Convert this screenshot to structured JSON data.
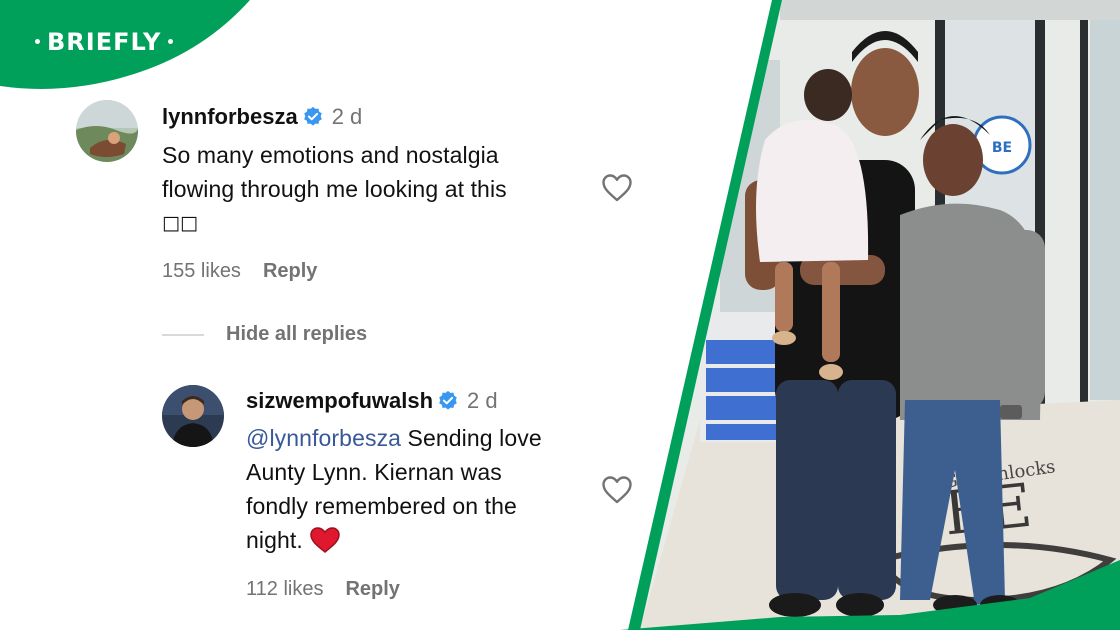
{
  "brand": {
    "name": "BRIEFLY",
    "color": "#00a05a"
  },
  "comments": [
    {
      "username": "lynnforbesza",
      "verified": true,
      "time": "2 d",
      "line1": "So many emotions and nostalgia",
      "line2": "flowing through me looking at this",
      "line3": "□□",
      "likes": "155 likes",
      "reply": "Reply",
      "icon": "heart-outline-icon"
    }
  ],
  "hide_replies": "Hide all replies",
  "replies": [
    {
      "username": "sizwempofuwalsh",
      "verified": true,
      "time": "2 d",
      "mention": "@lynnforbesza",
      "line1_rest": " Sending love",
      "line2": "Aunty Lynn. Kiernan was",
      "line3": "fondly remembered on the",
      "line4": "night.",
      "emoji": "red-heart-emoji",
      "likes": "112 likes",
      "reply": "Reply",
      "icon": "heart-outline-icon"
    }
  ],
  "photo": {
    "wall_sign_word": "BE",
    "floor_text_top": "G R  Unlocks",
    "floor_text_big": "BE",
    "accent_colors": {
      "shirt_grey": "#8c8e8e",
      "jeans": "#3d5f8f",
      "dress": "#f4eef0",
      "cabinet": "#3f6fd0"
    }
  }
}
